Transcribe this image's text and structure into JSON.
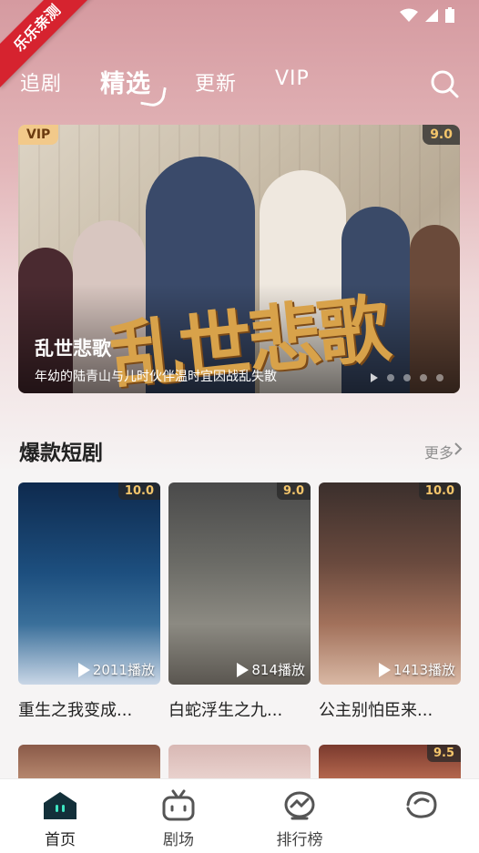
{
  "watermark": "乐乐亲测",
  "nav_tabs": [
    {
      "label": "追剧",
      "active": false
    },
    {
      "label": "精选",
      "active": true
    },
    {
      "label": "更新",
      "active": false
    },
    {
      "label": "VIP",
      "active": false
    }
  ],
  "banner": {
    "vip_badge": "VIP",
    "score": "9.0",
    "title": "乱世悲歌",
    "logo_text": "乱世悲歌",
    "subtitle": "年幼的陆青山与儿时伙伴温时宜因战乱失散"
  },
  "section": {
    "title": "爆款短剧",
    "more_label": "更多"
  },
  "cards": [
    {
      "score": "10.0",
      "plays": "2011播放",
      "title": "重生之我变成..."
    },
    {
      "score": "9.0",
      "plays": "814播放",
      "title": "白蛇浮生之九..."
    },
    {
      "score": "10.0",
      "plays": "1413播放",
      "title": "公主别怕臣来..."
    }
  ],
  "next_row": [
    {
      "score": ""
    },
    {
      "score": ""
    },
    {
      "score": "9.5"
    }
  ],
  "bottom_nav": [
    {
      "label": "首页",
      "icon": "home-icon",
      "active": true
    },
    {
      "label": "剧场",
      "icon": "tv-icon",
      "active": false
    },
    {
      "label": "排行榜",
      "icon": "ranking-icon",
      "active": false
    },
    {
      "label": "",
      "icon": "profile-icon",
      "active": false
    }
  ],
  "colors": {
    "accent": "#d6232f",
    "score": "#f3c56b",
    "vip_gold": "#f2c98a",
    "header_gradient_top": "#d59aa0"
  }
}
